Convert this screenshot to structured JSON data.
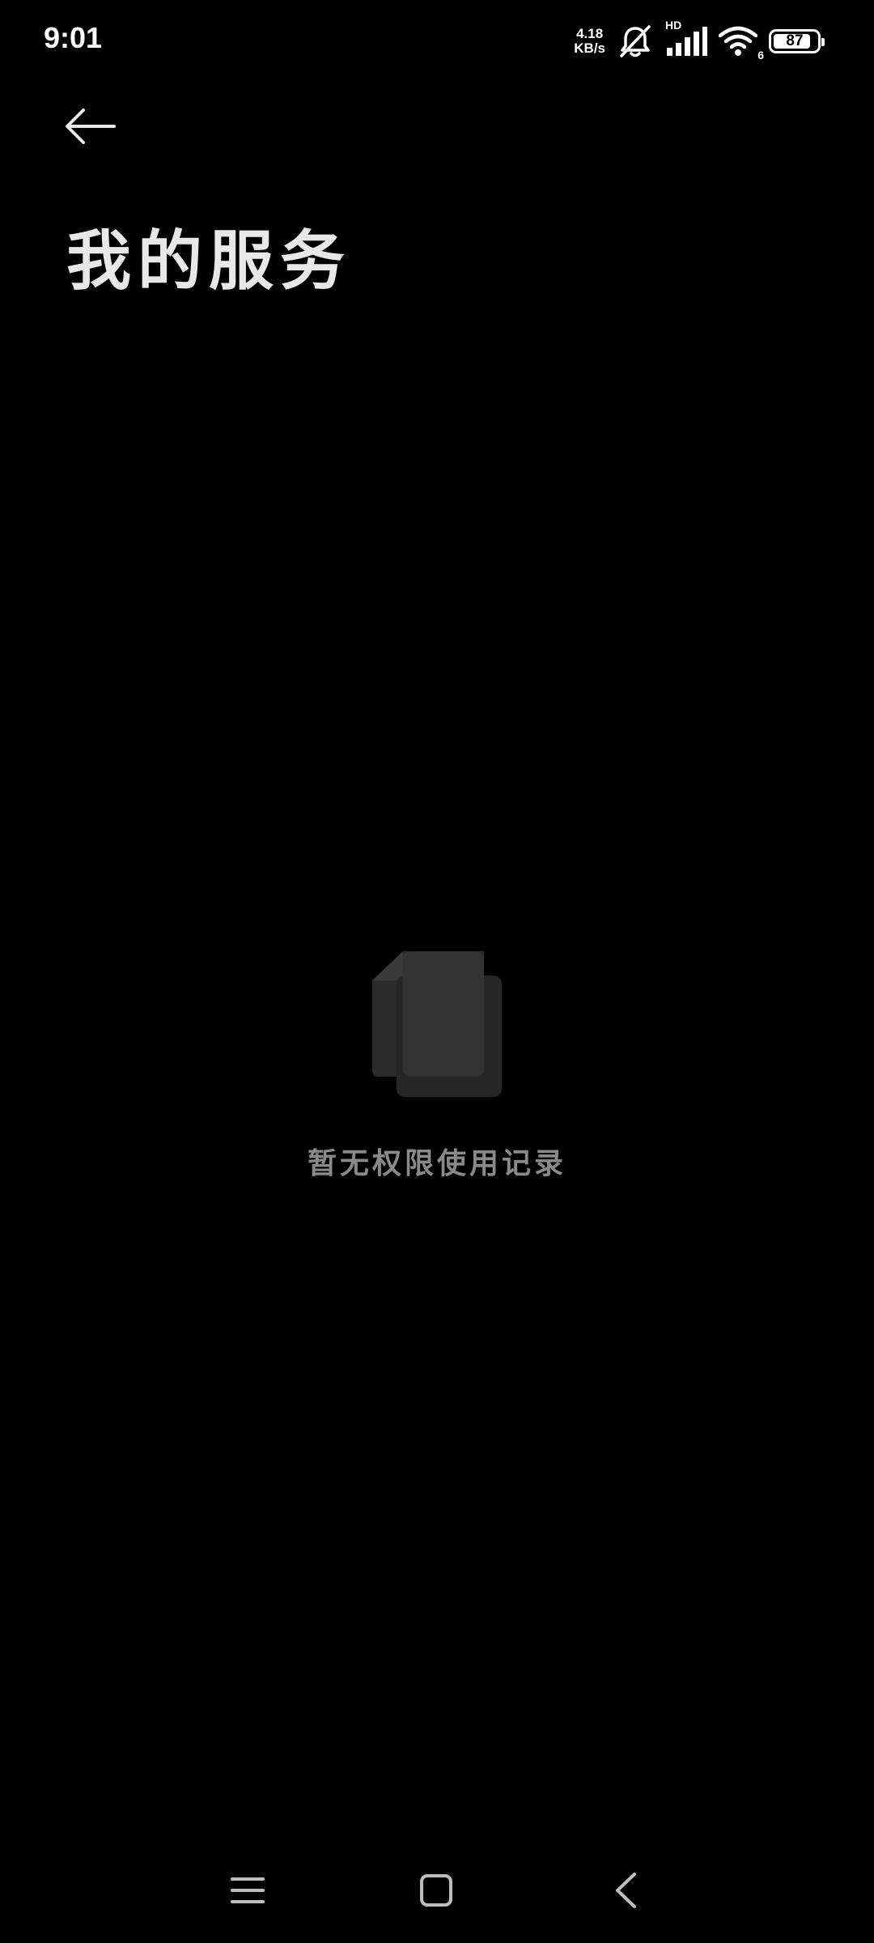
{
  "status_bar": {
    "time": "9:01",
    "net_speed_value": "4.18",
    "net_speed_unit": "KB/s",
    "signal_label": "HD",
    "wifi_label": "6",
    "battery_level": "87",
    "icons": [
      "mute-bell-icon",
      "signal-icon",
      "wifi-icon",
      "battery-icon"
    ]
  },
  "header": {
    "back_icon": "arrow-left-icon",
    "title": "我的服务"
  },
  "empty_state": {
    "icon": "empty-documents-icon",
    "message": "暂无权限使用记录"
  },
  "nav_bar": {
    "icons": [
      "menu-icon",
      "home-icon",
      "back-icon"
    ]
  },
  "colors": {
    "background": "#000000",
    "title": "#e8e8e8",
    "empty_text": "#8a8a8a",
    "illustration_back": "#2b2b2b",
    "illustration_front": "#3a3a3a"
  }
}
